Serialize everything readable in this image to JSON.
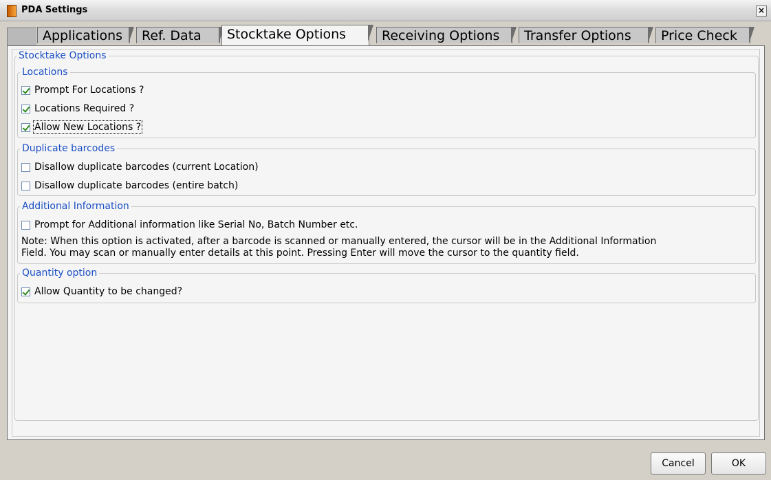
{
  "window": {
    "title": "PDA Settings",
    "close_glyph": "×"
  },
  "tabs": [
    {
      "label": "Applications"
    },
    {
      "label": "Ref. Data"
    },
    {
      "label": "Stocktake Options"
    },
    {
      "label": "Receiving Options"
    },
    {
      "label": "Transfer Options"
    },
    {
      "label": "Price Check"
    }
  ],
  "stocktake": {
    "legend": "Stocktake Options",
    "locations": {
      "legend": "Locations",
      "items": [
        {
          "label": "Prompt For Locations ?",
          "checked": true
        },
        {
          "label": "Locations Required ?",
          "checked": true
        },
        {
          "label": "Allow New Locations ?",
          "checked": true
        }
      ]
    },
    "duplicates": {
      "legend": "Duplicate barcodes",
      "items": [
        {
          "label": "Disallow duplicate barcodes (current Location)",
          "checked": false
        },
        {
          "label": "Disallow duplicate barcodes (entire batch)",
          "checked": false
        }
      ]
    },
    "additional": {
      "legend": "Additional Information",
      "items": [
        {
          "label": "Prompt for Additional information like Serial No, Batch Number etc.",
          "checked": false
        }
      ],
      "note_line1": "Note: When this option is activated, after a barcode is scanned or manually entered, the cursor will be in the Additional Information",
      "note_line2": "Field.  You may scan or manually enter details at this point.  Pressing Enter will move the cursor to the quantity field."
    },
    "quantity": {
      "legend": "Quantity option",
      "items": [
        {
          "label": "Allow Quantity to be changed?",
          "checked": true
        }
      ]
    }
  },
  "buttons": {
    "cancel": "Cancel",
    "ok": "OK"
  },
  "colors": {
    "legend": "#1a4fc4",
    "check": "#2e8b22"
  }
}
